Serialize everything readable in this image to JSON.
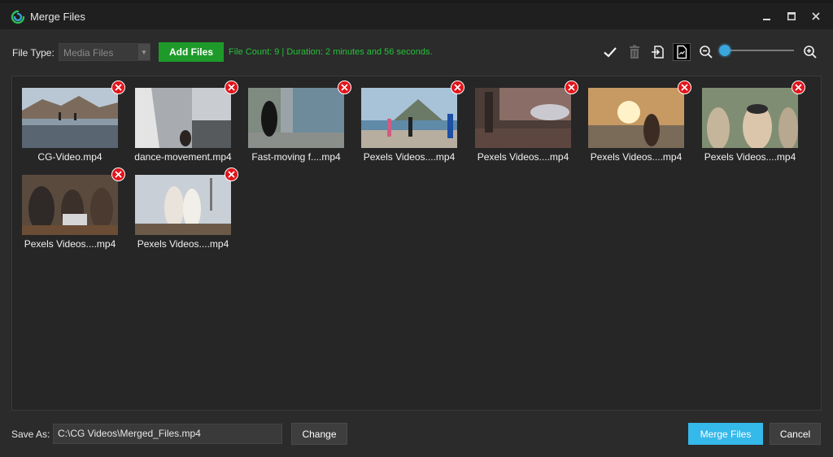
{
  "window": {
    "title": "Merge Files",
    "logo_icon": "cg-logo-icon",
    "controls": [
      "minimize-icon",
      "maximize-icon",
      "close-icon"
    ]
  },
  "toolbar": {
    "file_type_label": "File Type:",
    "file_type_value": "Media Files",
    "add_files_label": "Add Files",
    "status": "File Count: 9 | Duration: 2 minutes and 56 seconds.",
    "icons": [
      "check-icon",
      "trash-icon",
      "export-icon",
      "document-icon",
      "zoom-out-icon",
      "zoom-in-icon"
    ],
    "zoom_level": 0.05
  },
  "files": [
    {
      "name": "CG-Video.mp4"
    },
    {
      "name": "dance-movement.mp4"
    },
    {
      "name": "Fast-moving f....mp4"
    },
    {
      "name": "Pexels Videos....mp4"
    },
    {
      "name": "Pexels Videos....mp4"
    },
    {
      "name": "Pexels Videos....mp4"
    },
    {
      "name": "Pexels Videos....mp4"
    },
    {
      "name": "Pexels Videos....mp4"
    },
    {
      "name": "Pexels Videos....mp4"
    }
  ],
  "footer": {
    "save_as_label": "Save As:",
    "save_path": "C:\\CG Videos\\Merged_Files.mp4",
    "change_label": "Change",
    "merge_label": "Merge Files",
    "cancel_label": "Cancel"
  },
  "colors": {
    "accent_green": "#1e9a2a",
    "status_green": "#25c13a",
    "merge_blue": "#35b8ea",
    "remove_red": "#e2141b"
  }
}
